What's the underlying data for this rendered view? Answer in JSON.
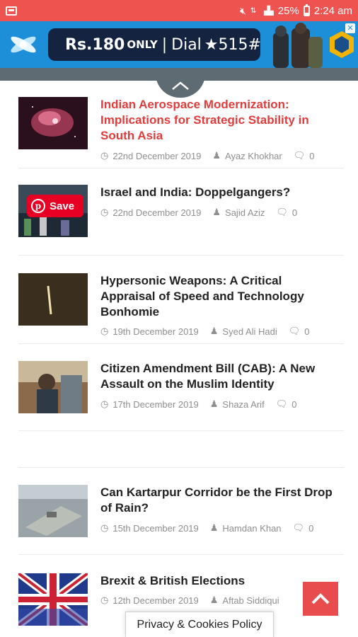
{
  "status_bar": {
    "battery": "25%",
    "time": "2:24 am",
    "background_color": "#ef5350"
  },
  "ad": {
    "price_text": "Rs.180",
    "price_suffix": "ONLY",
    "separator": "|",
    "dial_text": "Dial",
    "dial_code": "★515#",
    "close_icon": "close-icon",
    "background_color": "#1c8fd8"
  },
  "articles": [
    {
      "title": "Indian Aerospace Modernization: Implications for Strategic Stability in South Asia",
      "date": "22nd December 2019",
      "author": "Ayaz Khokhar",
      "comments": "0",
      "featured": true
    },
    {
      "title": "Israel and India: Doppelgangers?",
      "date": "22nd December 2019",
      "author": "Sajid Aziz",
      "comments": "0",
      "save_label": "Save"
    },
    {
      "title": "Hypersonic Weapons: A Critical Appraisal of Speed and Technology Bonhomie",
      "date": "19th December 2019",
      "author": "Syed Ali Hadi",
      "comments": "0"
    },
    {
      "title": "Citizen Amendment Bill (CAB): A New Assault on the Muslim Identity",
      "date": "17th December 2019",
      "author": "Shaza Arif",
      "comments": "0"
    },
    {
      "title": "Can Kartarpur Corridor be the First Drop of Rain?",
      "date": "15th December 2019",
      "author": "Hamdan Khan",
      "comments": "0"
    },
    {
      "title": "Brexit & British Elections",
      "date": "12th December 2019",
      "author": "Aftab Siddiqui",
      "comments": "0"
    }
  ],
  "privacy_label": "Privacy & Cookies Policy",
  "colors": {
    "accent": "#e84c4c",
    "featured_title": "#e03c3c",
    "meta_text": "#8f8f8f",
    "nav": "#5f6b72"
  }
}
